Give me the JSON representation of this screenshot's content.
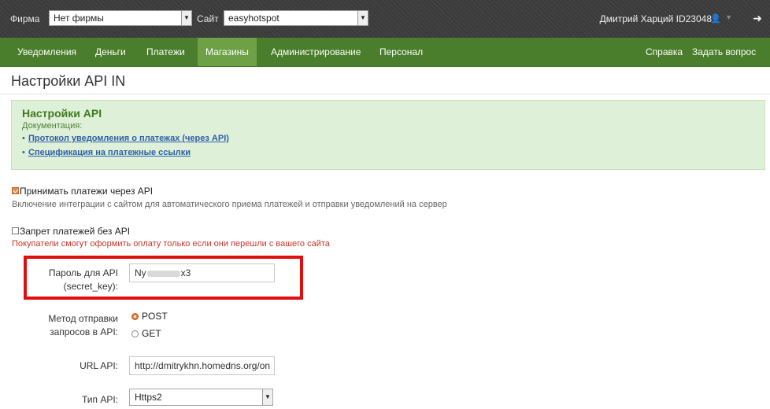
{
  "topbar": {
    "firm_label": "Фирма",
    "firm_value": "Нет фирмы",
    "site_label": "Сайт",
    "site_value": "easyhotspot",
    "dropdown_arrow": "▼",
    "user_name": "Дмитрий Харций ID23048",
    "user_icon": "user-icon",
    "user_icon_glyph": "👤",
    "user_caret": "▼",
    "logout_icon": "sign-out-icon",
    "logout_icon_glyph": "➜"
  },
  "nav": {
    "items": [
      "Уведомления",
      "Деньги",
      "Платежи",
      "Магазины",
      "Администрирование",
      "Персонал"
    ],
    "active_index": 3,
    "right_items": [
      "Справка",
      "Задать вопрос"
    ]
  },
  "page": {
    "title": "Настройки API IN"
  },
  "info": {
    "title": "Настройки API",
    "doc_label": "Документация:",
    "bullet": "•",
    "links": [
      "Протокол уведомления о платежах (через API)",
      "Спецификация на платежные ссылки"
    ]
  },
  "form": {
    "accept_api": {
      "label": "Принимать платежи через API",
      "checked": true,
      "hint": "Включение интеграции с сайтом для автоматического приема платежей и отправки уведомлений на сервер"
    },
    "ban_without_api": {
      "label": "Запрет платежей без API",
      "checked": false,
      "hint": "Покупатели смогут оформить оплату только если они перешли с вашего сайта"
    },
    "secret_key": {
      "label_line1": "Пароль для API",
      "label_line2": "(secret_key):",
      "value_prefix": "Ny",
      "value_suffix": "x3"
    },
    "method": {
      "label_line1": "Метод отправки",
      "label_line2": "запросов в API:",
      "options": [
        "POST",
        "GET"
      ],
      "selected": "POST"
    },
    "url": {
      "label": "URL API:",
      "value": "http://dmitrykhn.homedns.org/on"
    },
    "api_type": {
      "label": "Тип API:",
      "value": "Https2"
    }
  },
  "colors": {
    "nav_bg": "#4a7d2c",
    "nav_active": "#6ea145",
    "info_bg": "#dff0d8",
    "link": "#2d5ea9",
    "highlight": "#e10e0e"
  }
}
